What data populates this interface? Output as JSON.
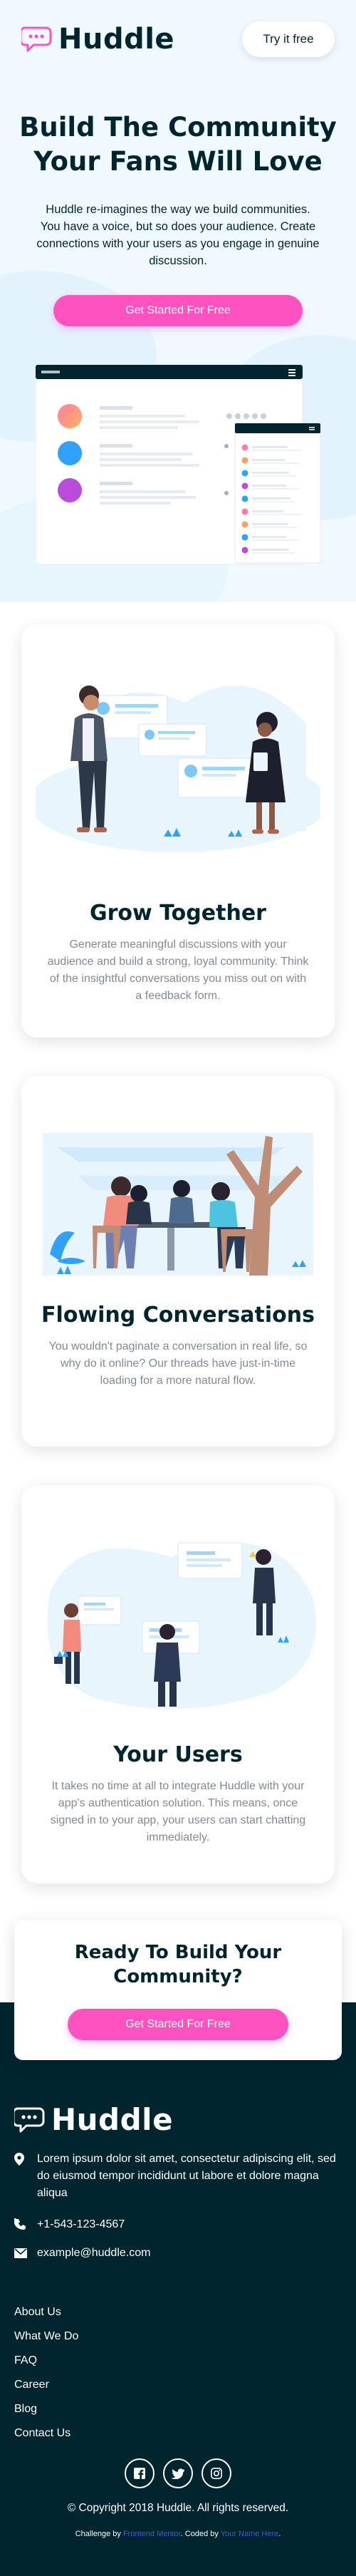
{
  "header": {
    "brand": "Huddle",
    "try_label": "Try it free"
  },
  "hero": {
    "title_line1": "Build The Community",
    "title_line2": "Your Fans Will Love",
    "text": "Huddle re-imagines the way we build communities. You have a voice, but so does your audience. Create connections with your users as you engage in genuine discussion.",
    "cta_label": "Get Started For Free"
  },
  "features": [
    {
      "title": "Grow Together",
      "text": "Generate meaningful discussions with your audience and build a strong, loyal community. Think of the insightful conversations you miss out on with a feedback form."
    },
    {
      "title": "Flowing Conversations",
      "text": "You wouldn't paginate a conversation in real life, so why do it online? Our threads have just-in-time loading for a more natural flow."
    },
    {
      "title": "Your Users",
      "text": "It takes no time at all to integrate Huddle with your app's authentication solution. This means, once signed in to your app, your users can start chatting immediately."
    }
  ],
  "ready": {
    "title_line1": "Ready To Build Your",
    "title_line2": "Community?",
    "cta_label": "Get Started For Free"
  },
  "footer": {
    "brand": "Huddle",
    "address": "Lorem ipsum dolor sit amet, consectetur adipiscing elit, sed do eiusmod tempor incididunt ut labore et dolore magna aliqua",
    "phone": "+1-543-123-4567",
    "email": "example@huddle.com",
    "links": [
      "About Us",
      "What We Do",
      "FAQ",
      "Career",
      "Blog",
      "Contact Us"
    ],
    "copyright": "© Copyright 2018 Huddle. All rights reserved.",
    "attribution": {
      "prefix": "Challenge by",
      "challenge_link": "Frontend Mentor",
      "middle": ". Coded by",
      "author_link": "Your Name Here",
      "suffix": "."
    }
  },
  "colors": {
    "primary_dark": "#00252e",
    "accent_pink": "#ff52c1",
    "hero_bg": "#f0f9ff",
    "muted_text": "#7f8a96"
  },
  "icons": [
    "chat-logo-icon",
    "location-pin-icon",
    "phone-icon",
    "mail-icon",
    "facebook-icon",
    "twitter-icon",
    "instagram-icon"
  ]
}
